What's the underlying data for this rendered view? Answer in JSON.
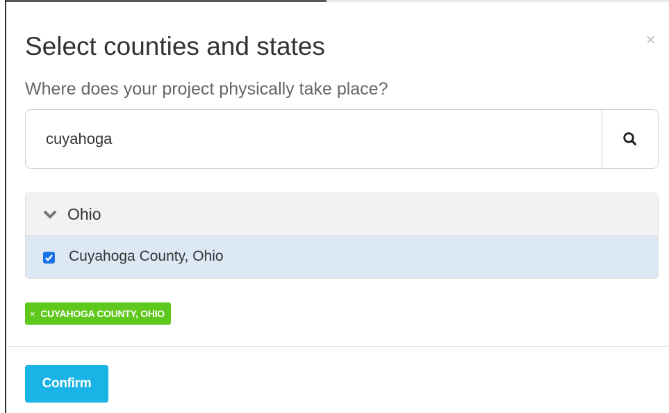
{
  "modal": {
    "title": "Select counties and states",
    "subtitle": "Where does your project physically take place?"
  },
  "search": {
    "value": "cuyahoga",
    "icon": "search-icon"
  },
  "results": {
    "group_label": "Ohio",
    "group_icon": "chevron-down-icon",
    "items": [
      {
        "label": "Cuyahoga County, Ohio",
        "checked": true
      }
    ]
  },
  "selected_tags": [
    {
      "label": "CUYAHOGA COUNTY, OHIO",
      "remove_symbol": "×"
    }
  ],
  "footer": {
    "confirm_label": "Confirm"
  },
  "colors": {
    "accent": "#1ab3e6",
    "tag_green": "#5fc81c",
    "checkbox_blue": "#1a73e8",
    "selected_row": "#dce9f5"
  }
}
